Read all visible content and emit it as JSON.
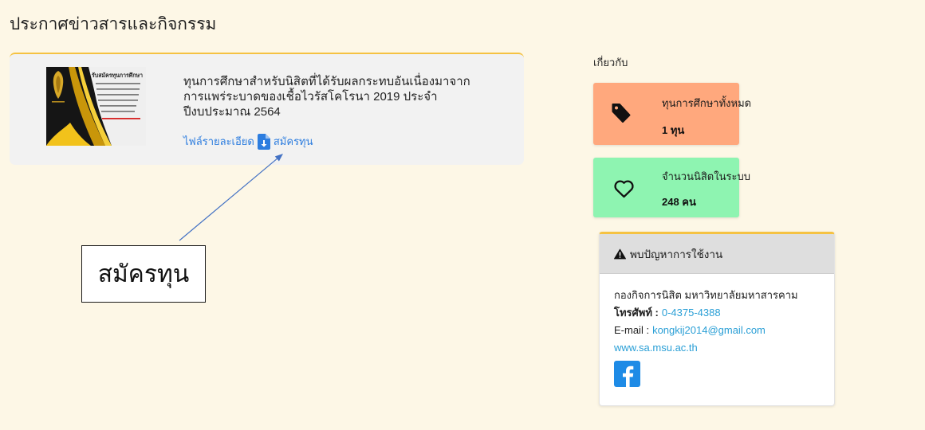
{
  "page": {
    "title": "ประกาศข่าวสารและกิจกรรม",
    "background": "#fdf7e6"
  },
  "announcement": {
    "poster": {
      "heading": "รับสมัครทุนการศึกษา"
    },
    "title_lines": [
      "ทุนการศึกษาสำหรับนิสิตที่ได้รับผลกระทบอันเนื่องมาจาก",
      "การแพร่ระบาดของเชื้อไวรัสโคโรนา 2019 ประจำ",
      "ปีงบประมาณ 2564"
    ],
    "details_link": "ไฟล์รายละเอียด",
    "apply_icon": "file-download-icon",
    "apply_link": "สมัครทุน",
    "accent_color": "#f5c242",
    "link_color": "#2d7ddf"
  },
  "annotation": {
    "label": "สมัครทุน",
    "arrow_color": "#4472c4"
  },
  "sidebar": {
    "about_label": "เกี่ยวกับ",
    "stats": [
      {
        "icon": "tag-icon",
        "label": "ทุนการศึกษาทั้งหมด",
        "value": "1 ทุน",
        "color": "#ffa87d"
      },
      {
        "icon": "heart-icon",
        "label": "จำนวนนิสิตในระบบ",
        "value": "248 คน",
        "color": "#8ef4b1"
      }
    ],
    "support": {
      "icon": "warning-icon",
      "title": "พบปัญหาการใช้งาน",
      "organization": "กองกิจการนิสิต มหาวิทยาลัยมหาสารคาม",
      "phone_label": "โทรศัพท์ :",
      "phone": "0-4375-4388",
      "email_label": "E-mail :",
      "email": "kongkij2014@gmail.com",
      "website": "www.sa.msu.ac.th",
      "social_icon": "facebook-icon",
      "link_color": "#2a9fd6"
    }
  }
}
